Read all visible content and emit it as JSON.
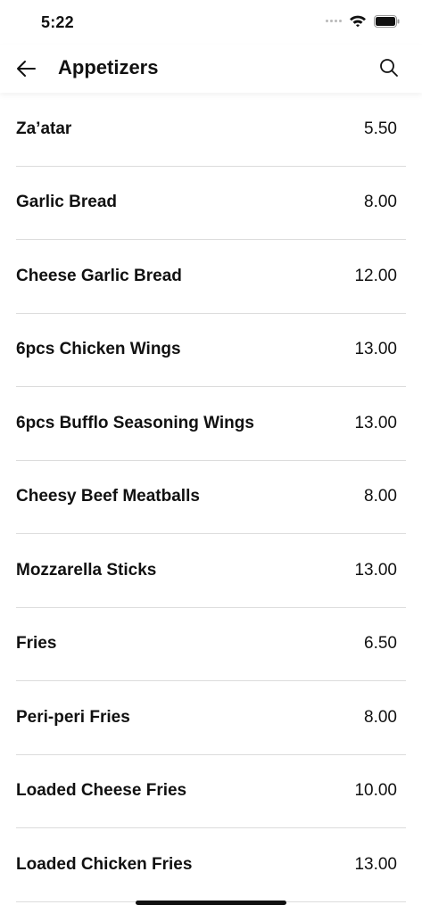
{
  "status_bar": {
    "time": "5:22",
    "icons": [
      "signal-icon",
      "wifi-icon",
      "battery-icon"
    ]
  },
  "header": {
    "title": "Appetizers",
    "back_icon": "arrow-left-icon",
    "search_icon": "search-icon"
  },
  "menu": {
    "items": [
      {
        "name": "Za’atar",
        "price": "5.50"
      },
      {
        "name": "Garlic Bread",
        "price": "8.00"
      },
      {
        "name": "Cheese Garlic Bread",
        "price": "12.00"
      },
      {
        "name": "6pcs Chicken Wings",
        "price": "13.00"
      },
      {
        "name": "6pcs Bufflo Seasoning Wings",
        "price": "13.00"
      },
      {
        "name": "Cheesy Beef Meatballs",
        "price": "8.00"
      },
      {
        "name": "Mozzarella Sticks",
        "price": "13.00"
      },
      {
        "name": "Fries",
        "price": "6.50"
      },
      {
        "name": "Peri-peri Fries",
        "price": "8.00"
      },
      {
        "name": "Loaded Cheese Fries",
        "price": "10.00"
      },
      {
        "name": "Loaded Chicken Fries",
        "price": "13.00"
      }
    ]
  },
  "colors": {
    "text": "#111111",
    "divider": "#dcdcdc",
    "background": "#ffffff"
  }
}
